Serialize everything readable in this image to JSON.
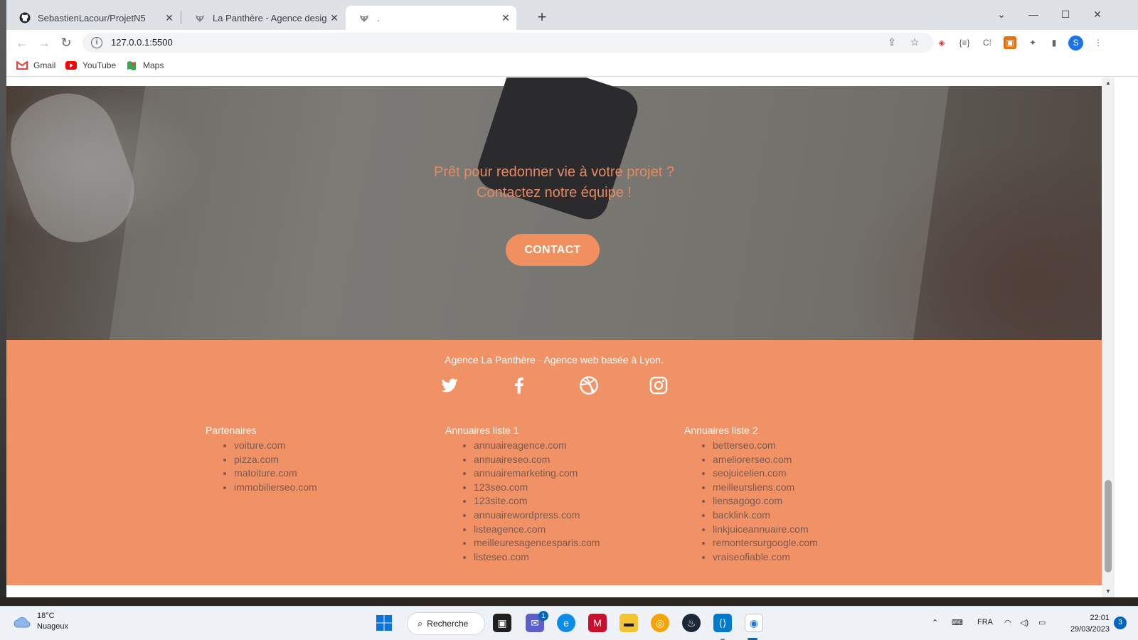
{
  "browser": {
    "tabs": [
      {
        "label": "SebastienLacour/ProjetN5",
        "icon": "github-icon"
      },
      {
        "label": "La Panthère - Agence design",
        "icon": "panther-icon"
      },
      {
        "label": ".",
        "icon": "panther-icon"
      }
    ],
    "new_tab": "+",
    "url": "127.0.0.1:5500",
    "profile_initial": "S",
    "bookmarks": [
      {
        "label": "Gmail",
        "icon": "gmail-icon"
      },
      {
        "label": "YouTube",
        "icon": "youtube-icon"
      },
      {
        "label": "Maps",
        "icon": "maps-icon"
      }
    ]
  },
  "page": {
    "hero": {
      "line1": "Prêt pour redonner vie à votre projet ?",
      "line2": "Contactez notre équipe !",
      "cta_label": "CONTACT"
    },
    "footer": {
      "tagline": "Agence La Panthère - Agence web basée à Lyon.",
      "social": [
        "twitter-icon",
        "facebook-icon",
        "dribbble-icon",
        "instagram-icon"
      ],
      "columns": [
        {
          "title": "Partenaires",
          "items": [
            "voiture.com",
            "pizza.com",
            "matoiture.com",
            "immobilierseo.com"
          ]
        },
        {
          "title": "Annuaires liste 1",
          "items": [
            "annuaireagence.com",
            "annuaireseo.com",
            "annuairemarketing.com",
            "123seo.com",
            "123site.com",
            "annuairewordpress.com",
            "listeagence.com",
            "meilleuresagencesparis.com",
            "listeseo.com"
          ]
        },
        {
          "title": "Annuaires liste 2",
          "items": [
            "betterseo.com",
            "ameliorerseo.com",
            "seojuicelien.com",
            "meilleursliens.com",
            "liensagogo.com",
            "backlink.com",
            "linkjuiceannuaire.com",
            "remontersurgoogle.com",
            "vraiseofiable.com"
          ]
        }
      ]
    }
  },
  "taskbar": {
    "weather_temp": "18°C",
    "weather_desc": "Nuageux",
    "search_label": "Recherche",
    "teams_badge": "1",
    "language": "FRA",
    "time": "22:01",
    "date": "29/03/2023",
    "notification_count": "3"
  },
  "colors": {
    "accent": "#f19266",
    "cta": "#f0905f",
    "hero_text": "#e58a60"
  }
}
